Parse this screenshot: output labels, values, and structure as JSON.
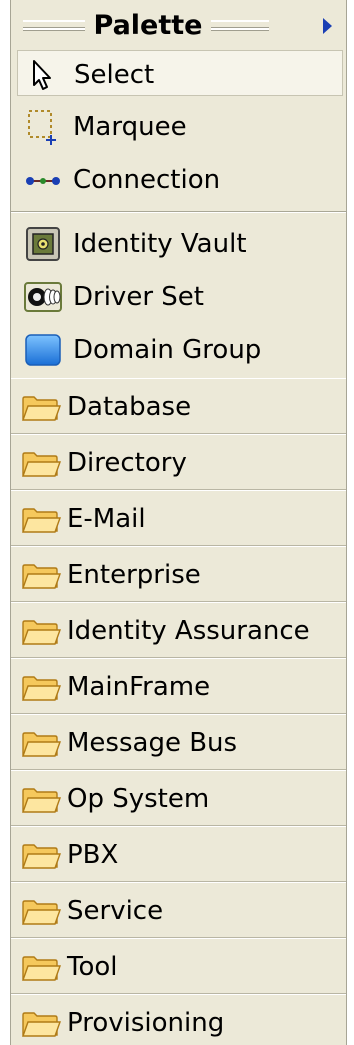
{
  "palette": {
    "title": "Palette",
    "tools": [
      {
        "label": "Select",
        "icon": "arrow-pointer-icon",
        "selected": true
      },
      {
        "label": "Marquee",
        "icon": "marquee-icon",
        "selected": false
      },
      {
        "label": "Connection",
        "icon": "connection-icon",
        "selected": false
      }
    ],
    "objects": [
      {
        "label": "Identity Vault",
        "icon": "identity-vault-icon"
      },
      {
        "label": "Driver Set",
        "icon": "driver-set-icon"
      },
      {
        "label": "Domain Group",
        "icon": "domain-group-icon"
      }
    ],
    "drawers": [
      {
        "label": "Database",
        "icon": "folder-icon"
      },
      {
        "label": "Directory",
        "icon": "folder-icon"
      },
      {
        "label": "E-Mail",
        "icon": "folder-icon"
      },
      {
        "label": "Enterprise",
        "icon": "folder-icon"
      },
      {
        "label": "Identity Assurance",
        "icon": "folder-icon"
      },
      {
        "label": "MainFrame",
        "icon": "folder-icon"
      },
      {
        "label": "Message Bus",
        "icon": "folder-icon"
      },
      {
        "label": "Op System",
        "icon": "folder-icon"
      },
      {
        "label": "PBX",
        "icon": "folder-icon"
      },
      {
        "label": "Service",
        "icon": "folder-icon"
      },
      {
        "label": "Tool",
        "icon": "folder-icon"
      },
      {
        "label": "Provisioning",
        "icon": "folder-icon"
      }
    ]
  },
  "colors": {
    "panel_bg": "#ece9d8",
    "selected_bg": "#f6f4ea",
    "arrow_blue": "#1a3fb4",
    "folder_yellow": "#fde6a0"
  }
}
